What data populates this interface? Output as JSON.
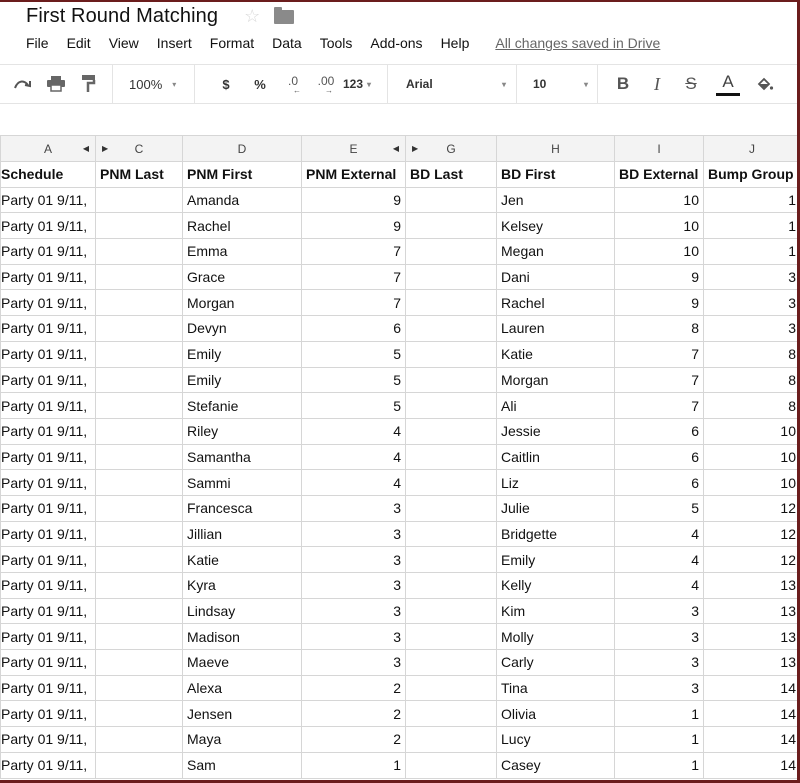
{
  "doc": {
    "title": "First Round Matching",
    "star_icon": "star-outline-icon",
    "folder_icon": "folder-icon"
  },
  "menu": {
    "items": [
      "File",
      "Edit",
      "View",
      "Insert",
      "Format",
      "Data",
      "Tools",
      "Add-ons",
      "Help"
    ],
    "save_status": "All changes saved in Drive"
  },
  "toolbar": {
    "redo_icon": "redo-icon",
    "print_icon": "print-icon",
    "paint_format_icon": "paint-format-icon",
    "zoom": "100%",
    "currency": "$",
    "percent": "%",
    "decrease_decimal": ".0",
    "increase_decimal": ".00",
    "more_formats": "123",
    "font": "Arial",
    "font_size": "10",
    "bold": "B",
    "italic": "I",
    "strikethrough": "S",
    "text_color": "A",
    "fill_color_icon": "fill-color-icon"
  },
  "columns": [
    "A",
    "C",
    "D",
    "E",
    "G",
    "H",
    "I",
    "J"
  ],
  "headers": [
    "Schedule",
    "PNM Last",
    "PNM First",
    "PNM External",
    "BD Last",
    "BD First",
    "BD External",
    "Bump Group"
  ],
  "rows": [
    [
      "Party 01 9/11,",
      "",
      "Amanda",
      "9",
      "",
      "Jen",
      "10",
      "1"
    ],
    [
      "Party 01 9/11,",
      "",
      "Rachel",
      "9",
      "",
      "Kelsey",
      "10",
      "1"
    ],
    [
      "Party 01 9/11,",
      "",
      "Emma",
      "7",
      "",
      "Megan",
      "10",
      "1"
    ],
    [
      "Party 01 9/11,",
      "",
      "Grace",
      "7",
      "",
      "Dani",
      "9",
      "3"
    ],
    [
      "Party 01 9/11,",
      "",
      "Morgan",
      "7",
      "",
      "Rachel",
      "9",
      "3"
    ],
    [
      "Party 01 9/11,",
      "",
      "Devyn",
      "6",
      "",
      "Lauren",
      "8",
      "3"
    ],
    [
      "Party 01 9/11,",
      "",
      "Emily",
      "5",
      "",
      "Katie",
      "7",
      "8"
    ],
    [
      "Party 01 9/11,",
      "",
      "Emily",
      "5",
      "",
      "Morgan",
      "7",
      "8"
    ],
    [
      "Party 01 9/11,",
      "",
      "Stefanie",
      "5",
      "",
      "Ali",
      "7",
      "8"
    ],
    [
      "Party 01 9/11,",
      "",
      "Riley",
      "4",
      "",
      "Jessie",
      "6",
      "10"
    ],
    [
      "Party 01 9/11,",
      "",
      "Samantha",
      "4",
      "",
      "Caitlin",
      "6",
      "10"
    ],
    [
      "Party 01 9/11,",
      "",
      "Sammi",
      "4",
      "",
      "Liz",
      "6",
      "10"
    ],
    [
      "Party 01 9/11,",
      "",
      "Francesca",
      "3",
      "",
      "Julie",
      "5",
      "12"
    ],
    [
      "Party 01 9/11,",
      "",
      "Jillian",
      "3",
      "",
      "Bridgette",
      "4",
      "12"
    ],
    [
      "Party 01 9/11,",
      "",
      "Katie",
      "3",
      "",
      "Emily",
      "4",
      "12"
    ],
    [
      "Party 01 9/11,",
      "",
      "Kyra",
      "3",
      "",
      "Kelly",
      "4",
      "13"
    ],
    [
      "Party 01 9/11,",
      "",
      "Lindsay",
      "3",
      "",
      "Kim",
      "3",
      "13"
    ],
    [
      "Party 01 9/11,",
      "",
      "Madison",
      "3",
      "",
      "Molly",
      "3",
      "13"
    ],
    [
      "Party 01 9/11,",
      "",
      "Maeve",
      "3",
      "",
      "Carly",
      "3",
      "13"
    ],
    [
      "Party 01 9/11,",
      "",
      "Alexa",
      "2",
      "",
      "Tina",
      "3",
      "14"
    ],
    [
      "Party 01 9/11,",
      "",
      "Jensen",
      "2",
      "",
      "Olivia",
      "1",
      "14"
    ],
    [
      "Party 01 9/11,",
      "",
      "Maya",
      "2",
      "",
      "Lucy",
      "1",
      "14"
    ],
    [
      "Party 01 9/11,",
      "",
      "Sam",
      "1",
      "",
      "Casey",
      "1",
      "14"
    ]
  ],
  "colors": {
    "frame": "#6b1d1d",
    "header_bg": "#f3f3f3",
    "gridline": "#d6d6d6"
  }
}
